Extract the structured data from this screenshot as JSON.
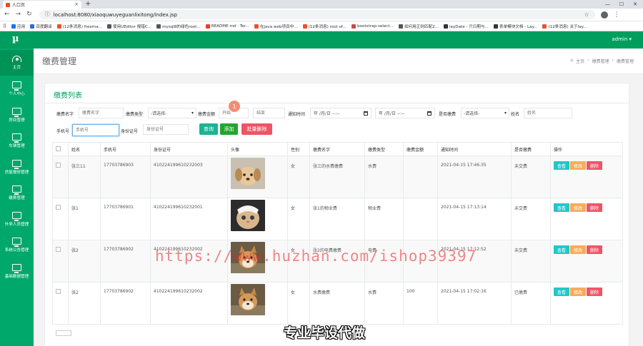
{
  "browser": {
    "tab_title": "人口页",
    "url": "localhost:8080/xiaoquwuyeguanlixitong/index.jsp",
    "bookmarks": [
      {
        "label": "应用",
        "color": "#1a73e8"
      },
      {
        "label": "百度翻译",
        "color": "#2d6bd8"
      },
      {
        "label": "(12条消息) freema...",
        "color": "#e8522d"
      },
      {
        "label": "使用UEditor 报错C...",
        "color": "#555555"
      },
      {
        "label": "mysql8的绿色root...",
        "color": "#555555"
      },
      {
        "label": "README.md · Ter...",
        "color": "#e8402d"
      },
      {
        "label": "在java web项目中...",
        "color": "#e8522d"
      },
      {
        "label": "(12条消息) root of...",
        "color": "#e8522d"
      },
      {
        "label": "bootstrap-select...",
        "color": "#c94b4b"
      },
      {
        "label": "如何用正则匹配2...",
        "color": "#555555"
      },
      {
        "label": "layDate - 只日期与...",
        "color": "#333333"
      },
      {
        "label": "表单模块文档 - Lay...",
        "color": "#333333"
      },
      {
        "label": "(12条消息) 关于lay...",
        "color": "#e8522d"
      }
    ]
  },
  "app": {
    "logo": "µ",
    "user_menu": "admin ▾",
    "sidebar": [
      {
        "label": "主页",
        "icon": "dashboard-icon"
      },
      {
        "label": "个人中心",
        "icon": "monitor-icon"
      },
      {
        "label": "房间管理",
        "icon": "monitor-icon"
      },
      {
        "label": "车辆管理",
        "icon": "monitor-icon"
      },
      {
        "label": "房屋报修管理",
        "icon": "monitor-icon"
      },
      {
        "label": "缴费管理",
        "icon": "monitor-icon"
      },
      {
        "label": "外来人员管理",
        "icon": "monitor-icon"
      },
      {
        "label": "系统公告管理",
        "icon": "monitor-icon"
      },
      {
        "label": "基础数据管理",
        "icon": "monitor-icon"
      }
    ],
    "page_title": "缴费管理",
    "breadcrumb": [
      "主页",
      "缴费管理",
      "缴费管理"
    ],
    "panel_title": "缴费列表"
  },
  "filters": {
    "fee_name_label": "缴费名字",
    "fee_name_placeholder": "缴费名字",
    "fee_type_label": "缴费类型",
    "fee_type_value": "-请选择-",
    "amount_label": "缴费金额",
    "amount_start_placeholder": "开始",
    "amount_end_placeholder": "结束",
    "notice_time_label": "通知时间",
    "date_placeholder": "年 /月/日 --:--",
    "paid_label": "是否缴费",
    "paid_value": "-请选择-",
    "name_label": "姓名",
    "name_placeholder": "姓名",
    "phone_label": "手机号",
    "phone_placeholder": "手机号",
    "idcard_label": "身份证号",
    "idcard_placeholder": "身份证号",
    "query_btn": "查询",
    "add_btn": "添加",
    "batch_delete_btn": "批量删除"
  },
  "table": {
    "headers": [
      "",
      "姓名",
      "手机号",
      "身份证号",
      "头像",
      "性别",
      "缴费名字",
      "缴费类型",
      "缴费金额",
      "通知时间",
      "是否缴费",
      "操作"
    ],
    "rows": [
      {
        "name": "张三11",
        "phone": "17703786903",
        "idcard": "410224199610232003",
        "avatar": "puppy-photo",
        "gender": "女",
        "fee_name": "张三的水费缴费",
        "fee_type": "水费",
        "amount": "",
        "time": "2021-04-15 17:46:35",
        "paid": "未交费"
      },
      {
        "name": "张1",
        "phone": "17703786901",
        "idcard": "410224199610232001",
        "avatar": "cat-photo",
        "gender": "女",
        "fee_name": "张1的物业费",
        "fee_type": "物业费",
        "amount": "",
        "time": "2021-04-15 17:13:14",
        "paid": "未交费"
      },
      {
        "name": "张2",
        "phone": "17703786902",
        "idcard": "410224199610232002",
        "avatar": "shiba-photo",
        "gender": "女",
        "fee_name": "张2的电费缴费",
        "fee_type": "电费",
        "amount": "",
        "time": "2021-04-15 17:12:52",
        "paid": "未交费"
      },
      {
        "name": "张2",
        "phone": "17703786902",
        "idcard": "410224199610232002",
        "avatar": "shiba-photo",
        "gender": "女",
        "fee_name": "水费缴费",
        "fee_type": "水费",
        "amount": "100",
        "time": "2021-04-15 17:02:16",
        "paid": "已缴费"
      }
    ],
    "view_btn": "查看",
    "edit_btn": "修改",
    "delete_btn": "删除"
  },
  "overlay": {
    "marker": "1",
    "watermark": "https://www.huzhan.com/ishop39397",
    "stamp": "专业毕设代做"
  },
  "colors": {
    "brand": "#009e5e",
    "sidebar": "#00a86b",
    "query": "#1ab394",
    "add": "#23a52d",
    "delete": "#ed5565",
    "view": "#23c6c8",
    "edit": "#f8ac59"
  }
}
